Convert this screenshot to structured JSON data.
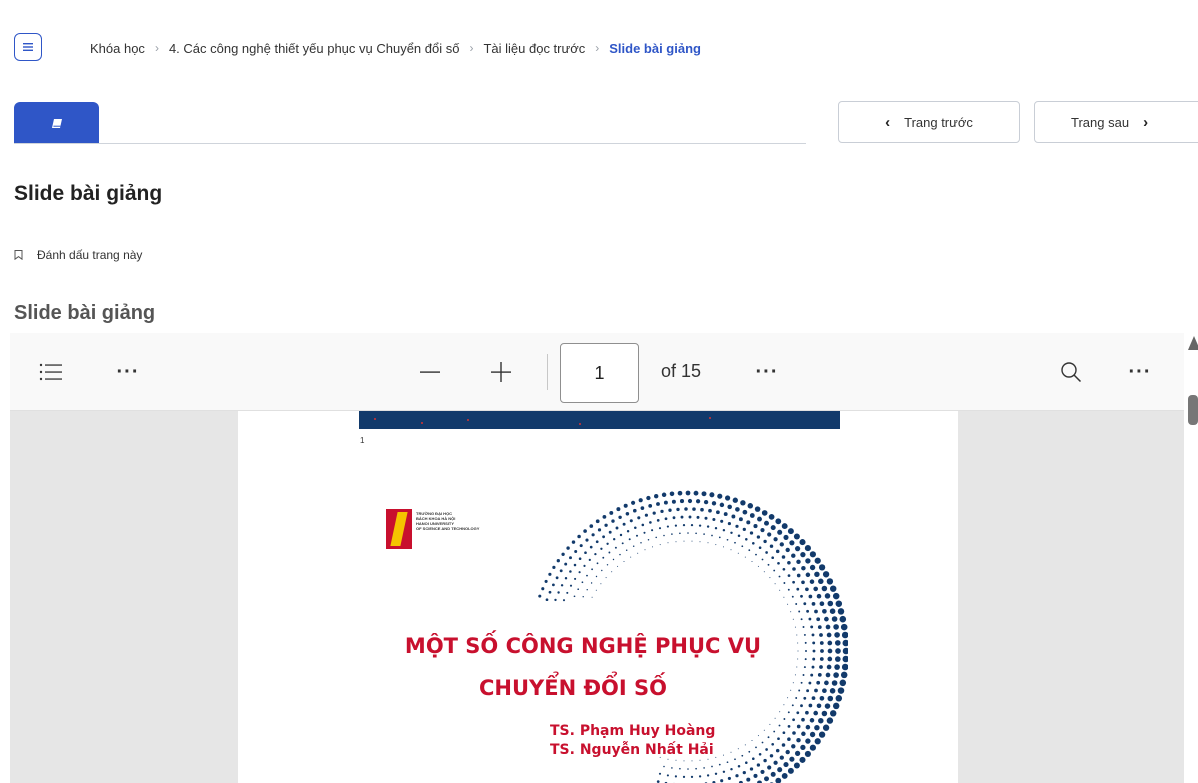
{
  "breadcrumb": {
    "items": [
      "Khóa học",
      "4. Các công nghệ thiết yếu phục vụ Chuyển đổi số",
      "Tài liệu đọc trước"
    ],
    "current": "Slide bài giảng",
    "separator": "›"
  },
  "icons": {
    "menu": "menu-icon",
    "tab": "book-icon",
    "bookmark": "bookmark-icon",
    "toc": "list-icon",
    "zoom_out": "minus-icon",
    "zoom_in": "plus-icon",
    "search": "search-icon"
  },
  "nav": {
    "prev_label": "Trang trước",
    "next_label": "Trang sau"
  },
  "page": {
    "title": "Slide bài giảng",
    "bookmark_label": "Đánh dấu trang này",
    "section_title": "Slide bài giảng"
  },
  "pdf": {
    "current_page": "1",
    "page_count_label": "of 15",
    "more_label": "···",
    "slide_page_number": "1",
    "logo_text": [
      "TRƯỜNG ĐẠI HỌC",
      "BÁCH KHOA HÀ NỘI",
      "HANOI UNIVERSITY",
      "OF SCIENCE AND TECHNOLOGY"
    ],
    "slide_title_line1": "MỘT SỐ CÔNG NGHỆ PHỤC VỤ",
    "slide_title_line2": "CHUYỂN ĐỔI SỐ",
    "author_1": "TS. Phạm Huy Hoàng",
    "author_2": "TS. Nguyễn Nhất Hải"
  },
  "colors": {
    "accent": "#2f56c7",
    "slide_red": "#c8102e",
    "slide_navy": "#123a6b",
    "logo_yellow": "#f5c400"
  }
}
